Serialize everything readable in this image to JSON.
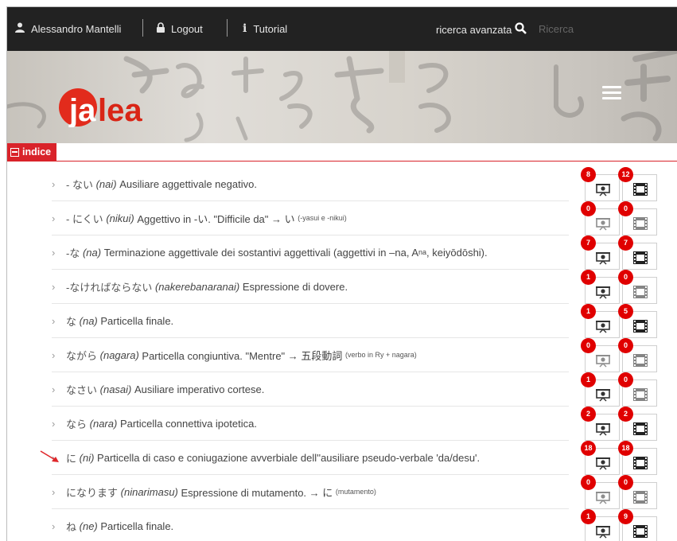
{
  "topbar": {
    "user_name": "Alessandro Mantelli",
    "logout_label": "Logout",
    "tutorial_label": "Tutorial",
    "advanced_search_label": "ricerca avanzata",
    "search_placeholder": "Ricerca"
  },
  "banner": {
    "logo_text": "jalea"
  },
  "indice_label": "indice",
  "entries": [
    {
      "prefix": "- ない",
      "romaji": "(nai)",
      "desc": "Ausiliare aggettivale negativo.",
      "note": "",
      "count_a": "8",
      "count_b": "12"
    },
    {
      "prefix": "- にくい",
      "romaji": "(nikui)",
      "desc": "Aggettivo in -い. \"Difficile da\" → い",
      "note": "(-yasui e -nikui)",
      "count_a": "0",
      "count_b": "0"
    },
    {
      "prefix": "-な",
      "romaji": "(na)",
      "desc": "Terminazione aggettivale dei sostantivi aggettivali (aggettivi in –na, A",
      "sub": "na",
      "desc2": ", keiyōdōshi).",
      "count_a": "7",
      "count_b": "7"
    },
    {
      "prefix": "-なければならない",
      "romaji": "(nakerebanaranai)",
      "desc": "Espressione di dovere.",
      "note": "",
      "count_a": "1",
      "count_b": "0"
    },
    {
      "prefix": "な",
      "romaji": "(na)",
      "desc": "Particella finale.",
      "note": "",
      "count_a": "1",
      "count_b": "5"
    },
    {
      "prefix": "ながら",
      "romaji": "(nagara)",
      "desc": "Particella congiuntiva. \"Mentre\" → 五段動詞",
      "note": "(verbo in Ry + nagara)",
      "count_a": "0",
      "count_b": "0"
    },
    {
      "prefix": "なさい",
      "romaji": "(nasai)",
      "desc": "Ausiliare imperativo cortese.",
      "note": "",
      "count_a": "1",
      "count_b": "0"
    },
    {
      "prefix": "なら",
      "romaji": "(nara)",
      "desc": "Particella connettiva ipotetica.",
      "note": "",
      "count_a": "2",
      "count_b": "2"
    },
    {
      "prefix": "に",
      "romaji": "(ni)",
      "desc": "Particella di caso e coniugazione avverbiale dell''ausiliare pseudo-verbale 'da/desu'.",
      "note": "",
      "count_a": "18",
      "count_b": "18"
    },
    {
      "prefix": "になります",
      "romaji": "(ninarimasu)",
      "desc": "Espressione di mutamento. → に",
      "note": "(mutamento)",
      "count_a": "0",
      "count_b": "0"
    },
    {
      "prefix": "ね",
      "romaji": "(ne)",
      "desc": "Particella finale.",
      "note": "",
      "count_a": "1",
      "count_b": "9"
    }
  ],
  "colors": {
    "topbar": "#222222",
    "accent_red": "#d9232a",
    "badge_red": "#e00000"
  },
  "icons": {
    "user": "user-icon",
    "lock": "lock-icon",
    "info": "info-icon",
    "search": "search-icon",
    "menu": "hamburger-icon",
    "audio": "presentation-icon",
    "video": "film-icon"
  }
}
